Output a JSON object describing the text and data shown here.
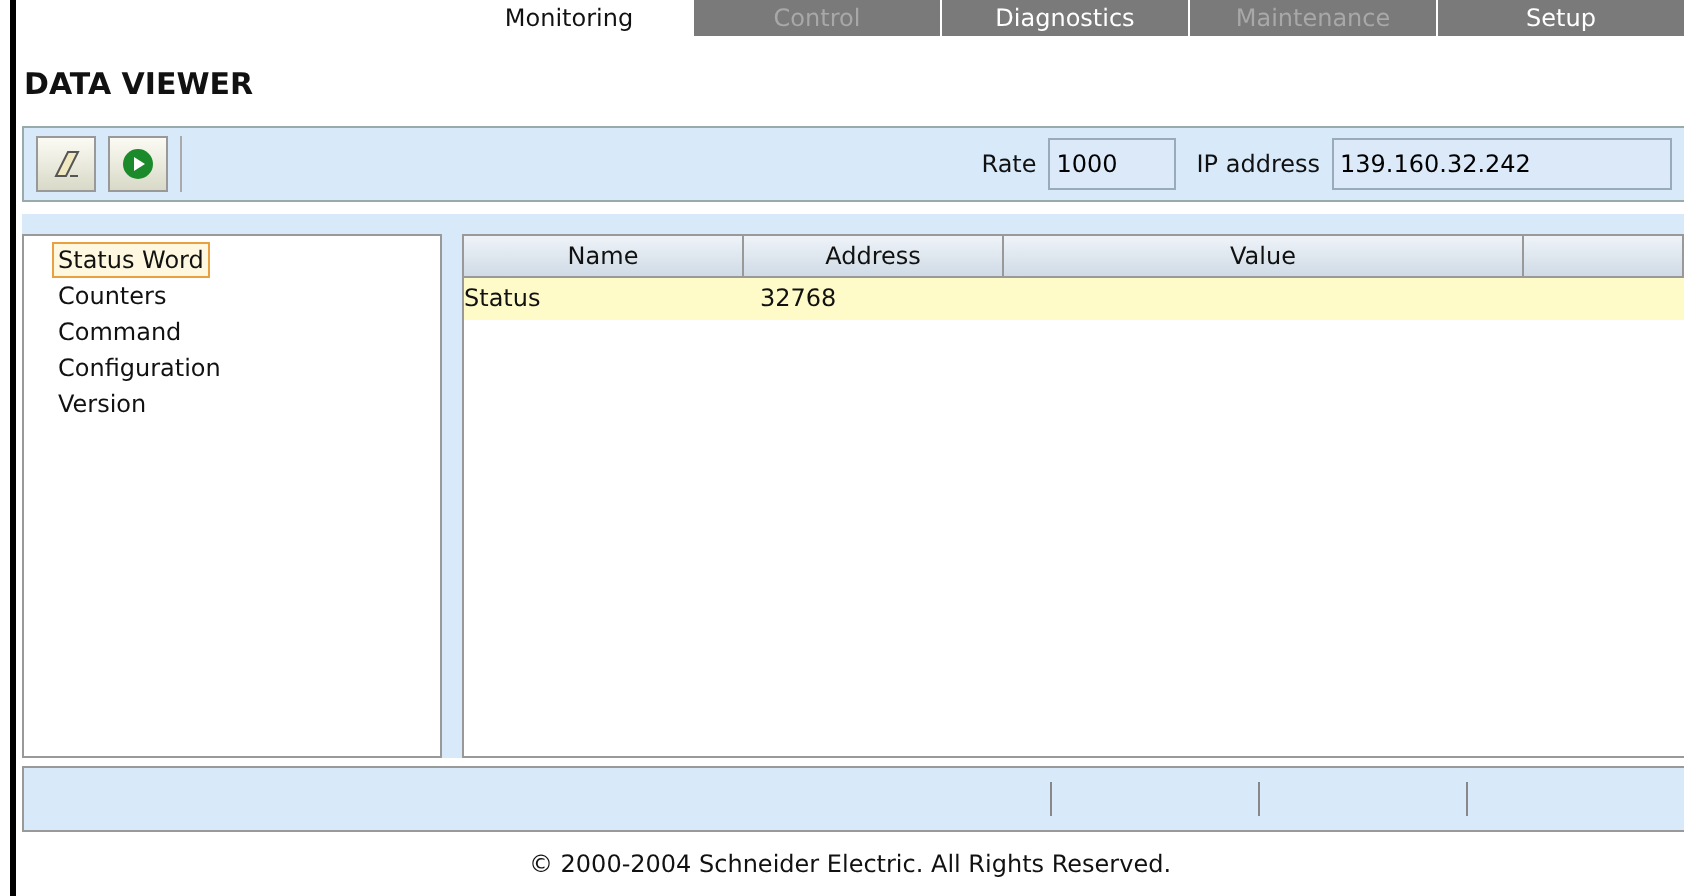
{
  "tabs": [
    {
      "label": "Monitoring",
      "selected": true,
      "disabled": false
    },
    {
      "label": "Control",
      "selected": false,
      "disabled": true
    },
    {
      "label": "Diagnostics",
      "selected": false,
      "disabled": false
    },
    {
      "label": "Maintenance",
      "selected": false,
      "disabled": true
    },
    {
      "label": "Setup",
      "selected": false,
      "disabled": false
    }
  ],
  "title": "DATA VIEWER",
  "toolbar": {
    "rate_label": "Rate",
    "rate": "1000",
    "ip_label": "IP address",
    "ip": "139.160.32.242"
  },
  "tree": [
    {
      "label": "Status Word",
      "selected": true
    },
    {
      "label": "Counters",
      "selected": false
    },
    {
      "label": "Command",
      "selected": false
    },
    {
      "label": "Configuration",
      "selected": false
    },
    {
      "label": "Version",
      "selected": false
    }
  ],
  "table": {
    "columns": [
      "Name",
      "Address",
      "Value",
      ""
    ],
    "rows": [
      {
        "cells": [
          "Status",
          "32768",
          "",
          ""
        ],
        "selected": true
      }
    ]
  },
  "footer": "© 2000-2004 Schneider Electric. All Rights Reserved."
}
